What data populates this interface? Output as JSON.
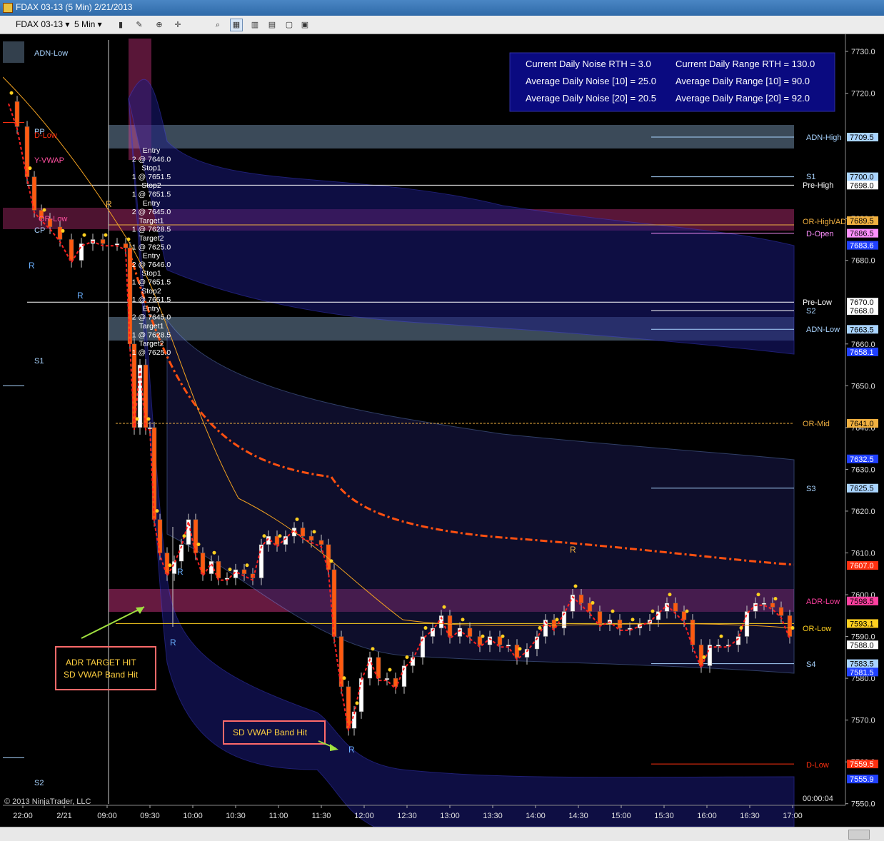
{
  "window": {
    "title": "FDAX 03-13 (5 Min)  2/21/2013"
  },
  "toolbar": {
    "instrument": "FDAX 03-13",
    "interval": "5 Min"
  },
  "info_box": {
    "l1": "Current Daily Noise RTH = 3.0",
    "r1": "Current Daily Range RTH = 130.0",
    "l2": "Average Daily Noise [10] = 25.0",
    "r2": "Average Daily Range [10] = 90.0",
    "l3": "Average Daily Noise [20] = 20.5",
    "r3": "Average Daily Range [20] = 92.0"
  },
  "colors": {
    "background": "#000000",
    "vwap": "#ff5010",
    "candle_up": "#ffffff",
    "candle_down": "#ff5a10",
    "band": "#2a2aa0",
    "info_box": "#0a0a80"
  },
  "left_labels": [
    "ADN-Low",
    "PP",
    "D-Low",
    "Y-VWAP",
    "OR-Low",
    "S1",
    "S2",
    "CP"
  ],
  "right_labels": [
    "ADN-High",
    "S1",
    "Pre-High",
    "OR-High/ADN",
    "D-Open",
    "Pre-Low",
    "S2",
    "ADN-Low",
    "OR-Mid",
    "S3",
    "ADR-Low",
    "OR-Low",
    "S4",
    "D-Low"
  ],
  "price_axis": {
    "ticks": [
      "7730.0",
      "7720.0",
      "7690.0",
      "7680.0",
      "7660.0",
      "7650.0",
      "7640.0",
      "7630.0",
      "7620.0",
      "7610.0",
      "7600.0",
      "7590.0",
      "7580.0",
      "7570.0",
      "7560.0",
      "7550.0"
    ],
    "markers": [
      {
        "label": "7709.5",
        "bg": "#a9d4ff"
      },
      {
        "label": "7700.0",
        "bg": "#a9d4ff"
      },
      {
        "label": "7698.0",
        "bg": "#ffffff"
      },
      {
        "label": "7689.5",
        "bg": "#f0b040"
      },
      {
        "label": "7686.5",
        "bg": "#ff90ff"
      },
      {
        "label": "7683.6",
        "bg": "#2040ff"
      },
      {
        "label": "7670.0",
        "bg": "#ffffff"
      },
      {
        "label": "7668.0",
        "bg": "#ffffff"
      },
      {
        "label": "7663.5",
        "bg": "#a9d4ff"
      },
      {
        "label": "7658.1",
        "bg": "#2040ff"
      },
      {
        "label": "7641.0",
        "bg": "#f0b040"
      },
      {
        "label": "7632.5",
        "bg": "#2040ff"
      },
      {
        "label": "7625.5",
        "bg": "#a9d4ff"
      },
      {
        "label": "7607.0",
        "bg": "#ff3010"
      },
      {
        "label": "7598.5",
        "bg": "#ff40a0"
      },
      {
        "label": "7593.1",
        "bg": "#ffd020"
      },
      {
        "label": "7588.0",
        "bg": "#ffffff"
      },
      {
        "label": "7583.5",
        "bg": "#a9d4ff"
      },
      {
        "label": "7581.5",
        "bg": "#2040ff"
      },
      {
        "label": "7559.5",
        "bg": "#ff3010"
      },
      {
        "label": "7555.9",
        "bg": "#2040ff"
      }
    ]
  },
  "time_axis": [
    "22:00",
    "2/21",
    "09:00",
    "09:30",
    "10:00",
    "10:30",
    "11:00",
    "11:30",
    "12:00",
    "12:30",
    "13:00",
    "13:30",
    "14:00",
    "14:30",
    "15:00",
    "15:30",
    "16:00",
    "16:30",
    "17:00"
  ],
  "orders": [
    "Entry",
    "2 @ 7646.0",
    "Stop1",
    "1 @ 7651.5",
    "Stop2",
    "1 @ 7651.5",
    "Entry",
    "2 @ 7645.0",
    "Target1",
    "1 @ 7628.5",
    "Target2",
    "1 @ 7625.0"
  ],
  "annotations": {
    "adr_hit_1": "ADR TARGET HIT",
    "adr_hit_2": "SD VWAP Band Hit",
    "sd_hit": "SD VWAP Band Hit"
  },
  "r_marker": "R",
  "copyright": "© 2013 NinjaTrader, LLC",
  "countdown": "00:00:04"
}
